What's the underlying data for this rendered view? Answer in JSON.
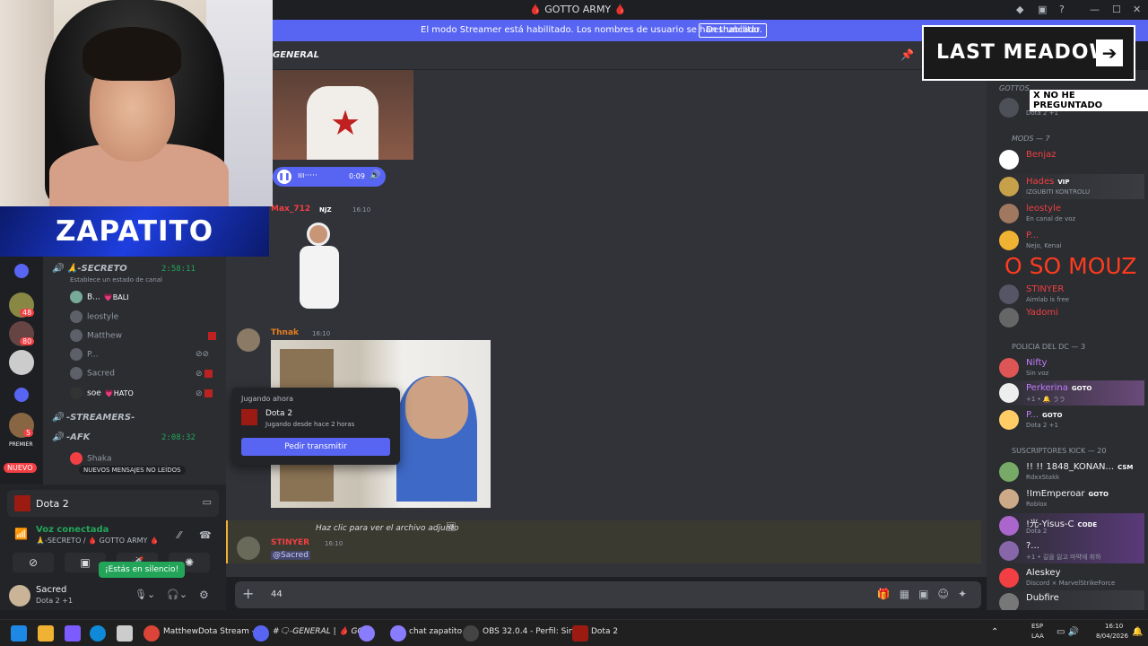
{
  "window": {
    "title": "🩸 GOTTO ARMY 🩸"
  },
  "streamer_banner": {
    "message": "El modo Streamer está habilitado. Los nombres de usuario se han truncado.",
    "button": "Deshabilitar"
  },
  "overlay": {
    "zapatito": "ZAPATITO",
    "last_meadow": "LAST MEADOW",
    "no_he": "X NO HE PREGUNTADO",
    "mouz": "O SO MOUZ"
  },
  "server_badges": [
    "48",
    "80",
    "5"
  ],
  "rail_new_label": "NUEVO",
  "rail_premier": "PREMIER",
  "channels": {
    "secreto": {
      "name": "🙏-SECRETO",
      "timer": "2:58:11",
      "status_hint": "Establece un estado de canal"
    },
    "members": [
      {
        "name": "B...",
        "tag": "💗BALI"
      },
      {
        "name": "leostyle",
        "tag": ""
      },
      {
        "name": "Matthew",
        "tag": ""
      },
      {
        "name": "P...",
        "tag": ""
      },
      {
        "name": "Sacred",
        "tag": ""
      },
      {
        "name": "soe",
        "tag": "💗HATO"
      }
    ],
    "streamers": "-STREAMERS-",
    "afk": {
      "name": "-AFK",
      "timer": "2:08:32"
    },
    "afk_member": "Shaka",
    "new_messages": "NUEVOS MENSAJES NO LEÍDOS"
  },
  "user_panel": {
    "game": "Dota 2",
    "voice_connected": "Voz conectada",
    "voice_channel": "🙏-SECRETO / 🩸 GOTTO ARMY 🩸",
    "tooltip": "¡Estás en silencio!",
    "username": "Sacred",
    "user_status": "Dota 2 +1"
  },
  "chat": {
    "channel": "GENERAL",
    "audio_time": "0:09",
    "msg1": {
      "user": "Max_712",
      "tag": "NJZ",
      "time": "16:10"
    },
    "msg2": {
      "user": "Thnak",
      "time": "16:10"
    },
    "popup": {
      "header": "Jugando ahora",
      "game": "Dota 2",
      "since": "Jugando desde hace 2 horas",
      "button": "Pedir transmitir"
    },
    "reply_preview": "Haz clic para ver el archivo adjunto",
    "msg3": {
      "user": "STINYER",
      "time": "16:10",
      "mention": "@Sacred"
    },
    "composer_text": "44"
  },
  "members": {
    "categories": {
      "gottos": "GOTTOS",
      "mods": "MODS — 7",
      "policia": "POLICIA DEL DC — 3",
      "suscriptores": "SUSCRIPTORES KICK — 20"
    },
    "gotto_member": {
      "status": "Dota 2 +1"
    },
    "mods": [
      {
        "name": "Benjaz",
        "status": ""
      },
      {
        "name": "Hades",
        "pill": "VIP",
        "status": "IZGUBITI KONTROLU"
      },
      {
        "name": "leostyle",
        "status": "En canal de voz"
      },
      {
        "name": "P...",
        "status": "Nejo, Kenai"
      },
      {
        "name": "STINYER",
        "status": "Aimlab is free"
      },
      {
        "name": "Yadomi",
        "status": ""
      }
    ],
    "policia": [
      {
        "name": "Nifty",
        "status": "Sin voz"
      },
      {
        "name": "Perkerina",
        "pill": "GOTO",
        "status": "+1 • 🔔 うう"
      },
      {
        "name": "P...",
        "pill": "GOTO",
        "status": "Dota 2 +1"
      }
    ],
    "subs": [
      {
        "name": "!! !! 1848_KONAN...",
        "pill": "CSM",
        "status": "RdxxStakk"
      },
      {
        "name": "!ImEmperoar",
        "pill": "GOTO",
        "status": "Roblox"
      },
      {
        "name": "!光-Yisus-C",
        "pill": "CODE",
        "status": "Dota 2"
      },
      {
        "name": "?...",
        "pill": "",
        "status": "+1 • 길을 잃고 마약에 취하"
      },
      {
        "name": "Aleskey",
        "pill": "",
        "status": "Discord × MarvelStrikeForce"
      },
      {
        "name": "Dubfire",
        "pill": "",
        "status": ""
      }
    ]
  },
  "taskbar": {
    "apps": [
      "MatthewDota Stream - ",
      "#🗨-GENERAL | 🩸 GO",
      "chat zapatito",
      "OBS 32.0.4 - Perfil: Sin T",
      "Dota 2"
    ],
    "lang": "ESP",
    "lang2": "LAA",
    "time": "16:10",
    "date": "8/04/2026"
  }
}
